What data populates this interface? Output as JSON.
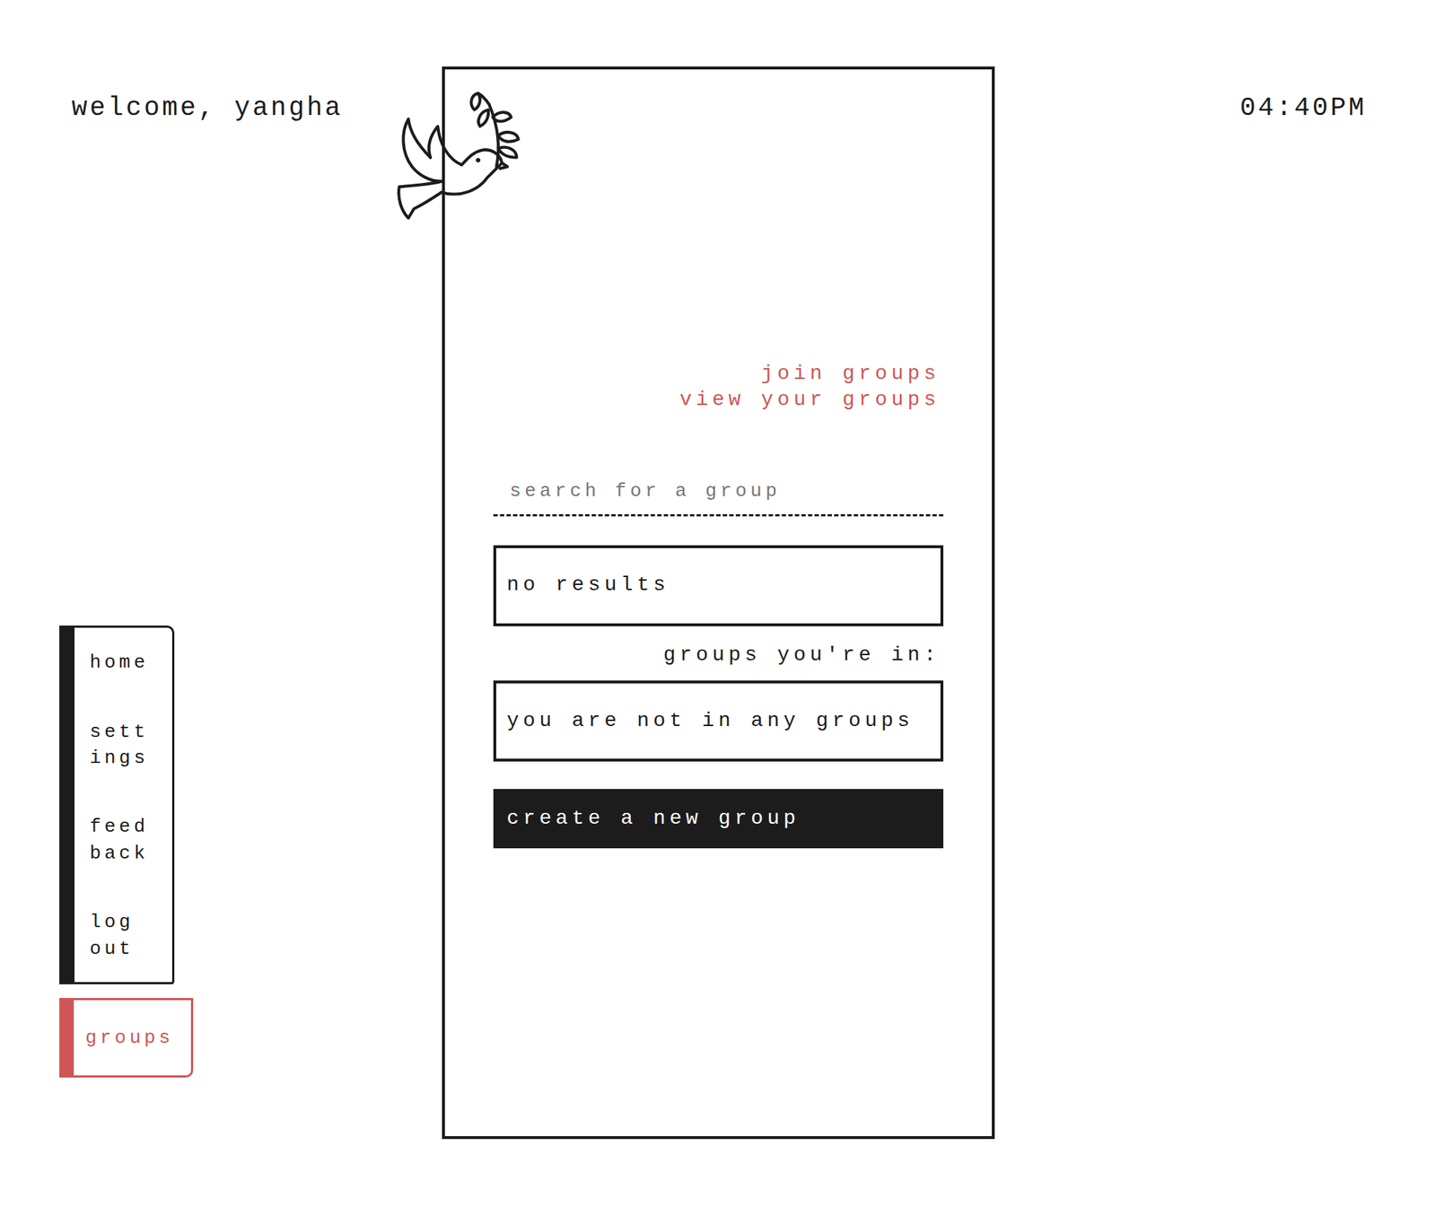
{
  "header": {
    "greeting": "welcome, yangha",
    "time": "04:40PM"
  },
  "sidebar": {
    "items": [
      {
        "label": "home",
        "selected": false
      },
      {
        "label": "settings",
        "selected": false
      },
      {
        "label": "feedback",
        "selected": false
      },
      {
        "label": "log out",
        "selected": false
      }
    ]
  },
  "groups_tab": {
    "label": "groups",
    "selected": true
  },
  "panel": {
    "links": [
      "join groups",
      "view your groups"
    ],
    "search": {
      "placeholder": "search for a group"
    },
    "results": "no results",
    "your_groups_heading": "groups you're in:",
    "your_groups": "you are not in any groups",
    "create_button": "create a new group"
  }
}
